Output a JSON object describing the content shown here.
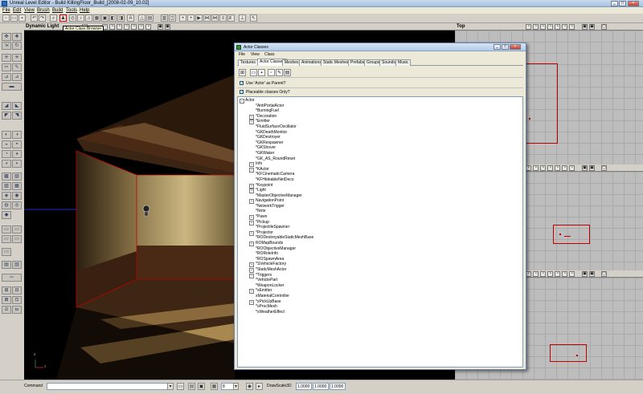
{
  "window": {
    "title": "Unreal Level Editor - Build KillingFloor_Build_[2008-02-09_10.02]"
  },
  "menubar": {
    "items": [
      "File",
      "Edit",
      "View",
      "Brush",
      "Build",
      "Tools",
      "Help"
    ]
  },
  "tooltip": {
    "text": "Actor Class Browser"
  },
  "perspective_viewport": {
    "title": "Dynamic Light",
    "axis_x": "x",
    "axis_z": "z"
  },
  "top_viewport": {
    "title": "Top"
  },
  "dialog": {
    "title": "Actor Classes",
    "menu": [
      "File",
      "View",
      "Class"
    ],
    "tabs": [
      "Textures",
      "Actor Classes",
      "Meshes",
      "Animations",
      "Static Meshes",
      "Prefabs",
      "Groups",
      "Sounds",
      "Music"
    ],
    "active_tab": "Actor Classes",
    "use_actor_as_parent": {
      "label": "Use 'Actor' as Parent?",
      "checked": true
    },
    "placeable_only": {
      "label": "Placeable classes Only?",
      "checked": true
    },
    "tree": {
      "root": "Actor",
      "items": [
        {
          "label": "*AntiPortalActor",
          "expandable": false
        },
        {
          "label": "*BurningFuel",
          "expandable": false
        },
        {
          "label": "*Decoration",
          "expandable": true
        },
        {
          "label": "*Emitter",
          "expandable": true
        },
        {
          "label": "*FluidSurfaceOscillator",
          "expandable": false
        },
        {
          "label": "*GKDeathMonitor",
          "expandable": false
        },
        {
          "label": "*GKDestroyer",
          "expandable": false
        },
        {
          "label": "*GKRespawner",
          "expandable": false
        },
        {
          "label": "*GKShover",
          "expandable": false
        },
        {
          "label": "*GKWaker",
          "expandable": false
        },
        {
          "label": "*GK_AS_RoundReset",
          "expandable": false
        },
        {
          "label": "Info",
          "expandable": true
        },
        {
          "label": "*KActor",
          "expandable": true
        },
        {
          "label": "*KFCinematicCamera",
          "expandable": false
        },
        {
          "label": "*KFHideableNetDeco",
          "expandable": false
        },
        {
          "label": "*Keypoint",
          "expandable": true
        },
        {
          "label": "*Light",
          "expandable": true
        },
        {
          "label": "*MasterObjectiveManager",
          "expandable": false
        },
        {
          "label": "NavigationPoint",
          "expandable": true
        },
        {
          "label": "*NetworkTrigger",
          "expandable": false
        },
        {
          "label": "*Note",
          "expandable": false
        },
        {
          "label": "*Pawn",
          "expandable": true
        },
        {
          "label": "*Pickup",
          "expandable": true
        },
        {
          "label": "*ProjectileSpawner",
          "expandable": false
        },
        {
          "label": "*Projector",
          "expandable": true
        },
        {
          "label": "*RODestroyableStaticMeshBase",
          "expandable": false
        },
        {
          "label": "ROMapBounds",
          "expandable": true
        },
        {
          "label": "*ROObjectiveManager",
          "expandable": false
        },
        {
          "label": "*RORoleInfo",
          "expandable": false
        },
        {
          "label": "*ROSpawnArea",
          "expandable": false
        },
        {
          "label": "*SVehicleFactory",
          "expandable": true
        },
        {
          "label": "*StaticMeshActor",
          "expandable": true
        },
        {
          "label": "*Triggers",
          "expandable": true
        },
        {
          "label": "*VehiclePart",
          "expandable": false
        },
        {
          "label": "*WeaponLocker",
          "expandable": false
        },
        {
          "label": "*xEmitter",
          "expandable": true
        },
        {
          "label": "xMaterialController",
          "expandable": false
        },
        {
          "label": "*xPickUpBase",
          "expandable": true
        },
        {
          "label": "*xProcMesh",
          "expandable": false
        },
        {
          "label": "*xWeatherEffect",
          "expandable": false
        }
      ]
    }
  },
  "statusbar": {
    "command_label": "Command",
    "drawscale_label": "DrawScale3D",
    "grid_value": "8",
    "drawscale_x": "1.0000",
    "drawscale_y": "1.0000",
    "drawscale_z": "1.0000"
  },
  "colors": {
    "selection_red": "#c00000",
    "wall_light": "#c4ae76",
    "wood": "#4a2a14"
  }
}
